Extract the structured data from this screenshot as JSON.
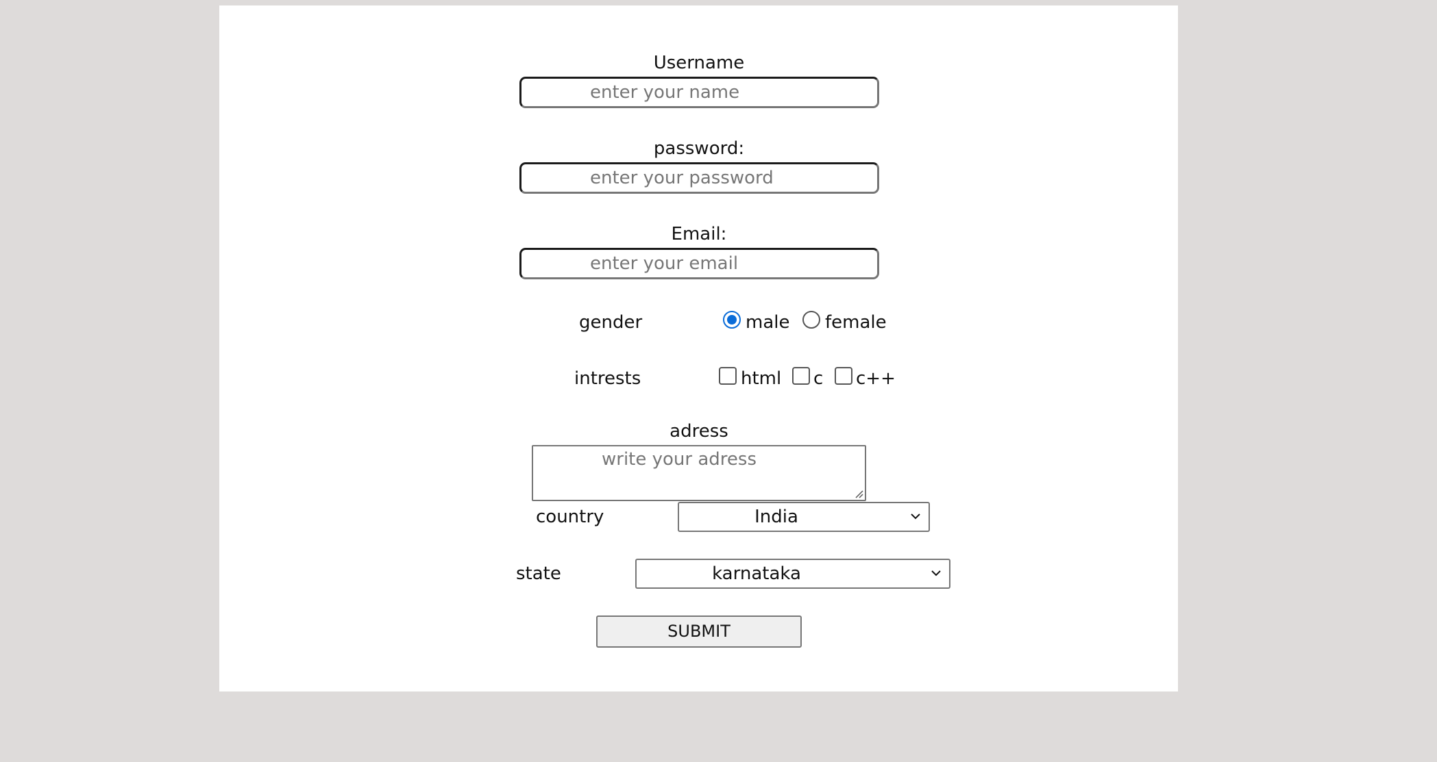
{
  "form": {
    "username": {
      "label": "Username",
      "placeholder": "enter your name"
    },
    "password": {
      "label": "password:",
      "placeholder": "enter your password"
    },
    "email": {
      "label": "Email:",
      "placeholder": "enter your email"
    },
    "gender": {
      "label": "gender",
      "options": [
        {
          "label": "male",
          "checked": true
        },
        {
          "label": "female",
          "checked": false
        }
      ]
    },
    "interests": {
      "label": "intrests",
      "options": [
        {
          "label": "html",
          "checked": false
        },
        {
          "label": "c",
          "checked": false
        },
        {
          "label": "c++",
          "checked": false
        }
      ]
    },
    "address": {
      "label": "adress",
      "placeholder": "write your adress"
    },
    "country": {
      "label": "country",
      "selected": "India"
    },
    "state": {
      "label": "state",
      "selected": "karnataka"
    },
    "submit_label": "SUBMIT"
  },
  "colors": {
    "background": "#dedbda",
    "card": "#ffffff",
    "accent": "#0a6cd8"
  }
}
